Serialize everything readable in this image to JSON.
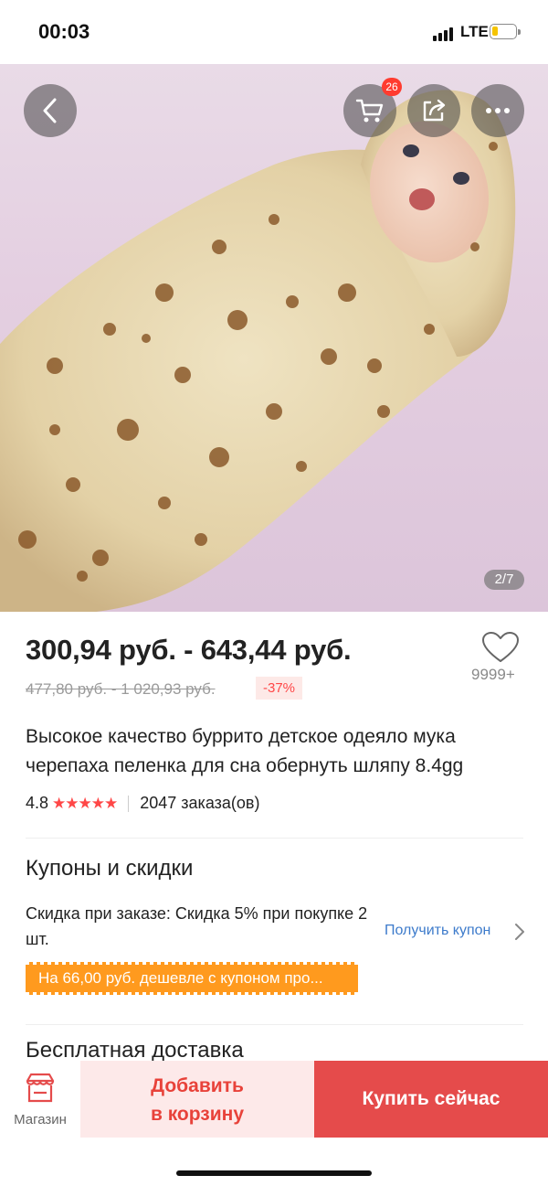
{
  "status_bar": {
    "time": "00:03",
    "network": "LTE"
  },
  "hero": {
    "image_counter": "2/7",
    "cart_badge": "26",
    "icons": [
      "back-icon",
      "cart-icon",
      "share-icon",
      "more-icon"
    ]
  },
  "product": {
    "price_range": "300,94 руб. - 643,44 руб.",
    "old_price_range": "477,80 руб. - 1 020,93 руб.",
    "discount": "-37%",
    "wishlist_count": "9999+",
    "title": "Высокое качество буррито детское одеяло мука черепаха пеленка для сна обернуть шляпу 8.4gg",
    "rating": "4.8",
    "stars": "★★★★★",
    "orders": "2047 заказа(ов)"
  },
  "coupons": {
    "heading": "Купоны и скидки",
    "text": "Скидка при заказе: Скидка 5% при покупке 2 шт.",
    "get_coupon_label": "Получить купон",
    "banner": "На 66,00 руб. дешевле с купоном про..."
  },
  "shipping": {
    "heading": "Бесплатная доставка"
  },
  "bottom_bar": {
    "shop_label": "Магазин",
    "add_to_cart_line1": "Добавить",
    "add_to_cart_line2": "в корзину",
    "buy_now_label": "Купить сейчас"
  },
  "colors": {
    "accent_red": "#e54b4b",
    "price_text": "#222222",
    "discount_red": "#ff4747",
    "coupon_orange": "#ff9a1e",
    "link_blue": "#3d7bcb"
  }
}
